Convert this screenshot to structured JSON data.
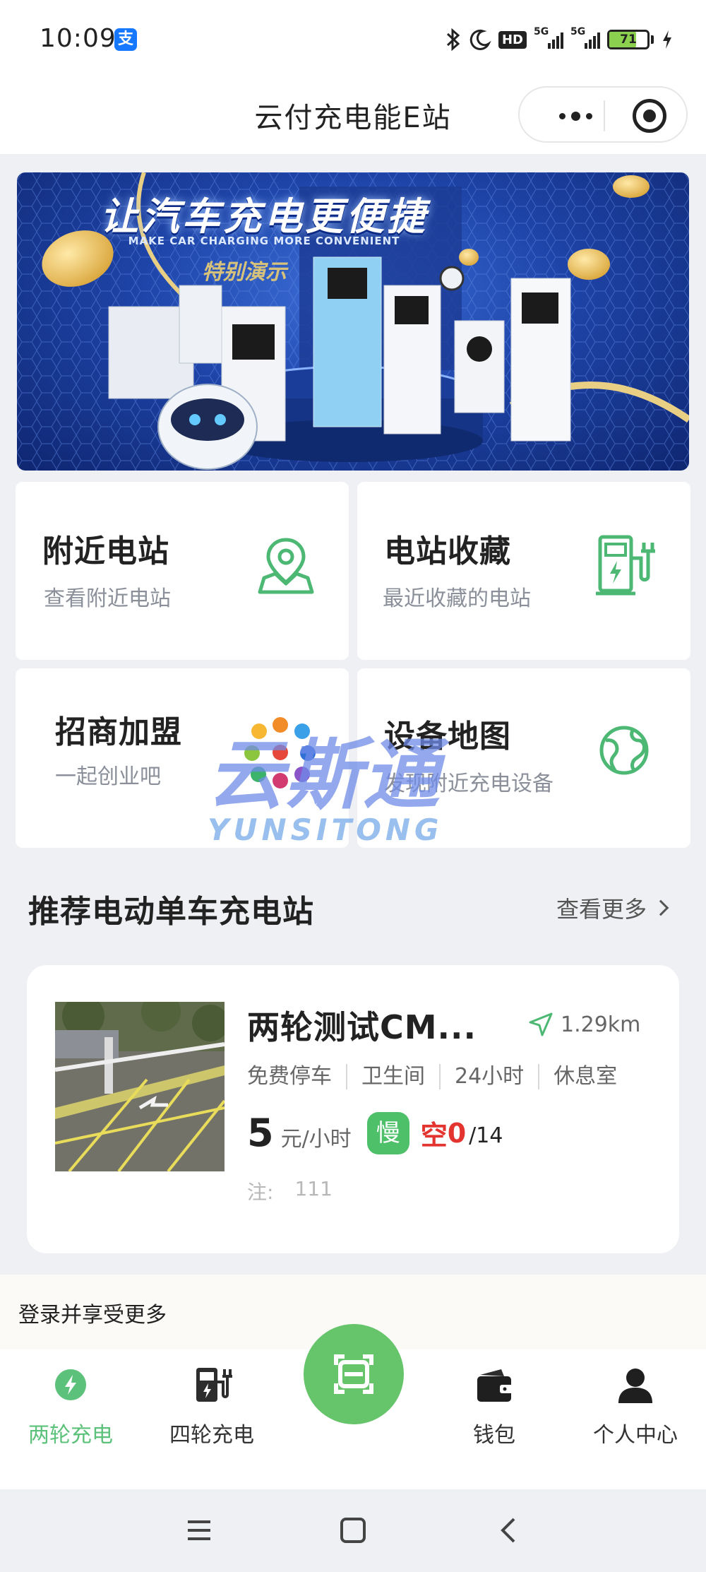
{
  "status_bar": {
    "time": "10:09",
    "alipay_icon": "支",
    "hd_label": "HD",
    "network_1": "5G",
    "network_2": "5G",
    "battery_level": "71",
    "battery_fraction": 0.71
  },
  "header": {
    "title": "云付充电能E站",
    "more_icon": "more-dots-icon",
    "close_icon": "target-circle-icon"
  },
  "banner": {
    "title": "让汽车充电更便捷",
    "subtitle": "MAKE CAR CHARGING MORE CONVENIENT",
    "tag": "特别演示"
  },
  "tiles": [
    {
      "title": "附近电站",
      "subtitle": "查看附近电站",
      "icon": "map-pin-icon"
    },
    {
      "title": "电站收藏",
      "subtitle": "最近收藏的电站",
      "icon": "charging-pile-icon"
    },
    {
      "title": "招商加盟",
      "subtitle": "一起创业吧",
      "icon": "colorful-dots-logo-icon"
    },
    {
      "title": "设备地图",
      "subtitle": "发现附近充电设备",
      "icon": "globe-map-icon"
    }
  ],
  "watermark": {
    "cn": "云斯通",
    "en": "YUNSITONG"
  },
  "section": {
    "title": "推荐电动单车充电站",
    "more": "查看更多"
  },
  "station": {
    "name": "两轮测试CM...",
    "distance": "1.29km",
    "amenities": [
      "免费停车",
      "卫生间",
      "24小时",
      "休息室"
    ],
    "price": "5",
    "price_unit": "元/小时",
    "speed_badge": "慢",
    "free_label": "空",
    "free_count": "0",
    "total_count": "/14",
    "note_label": "注:",
    "note_value": "111"
  },
  "login_prompt": "登录并享受更多",
  "tabbar": {
    "items": [
      {
        "label": "两轮充电",
        "icon": "lightning-icon",
        "active": true
      },
      {
        "label": "四轮充电",
        "icon": "fuel-pump-icon",
        "active": false
      },
      {
        "label": "钱包",
        "icon": "wallet-icon",
        "active": false
      },
      {
        "label": "个人中心",
        "icon": "user-icon",
        "active": false
      }
    ],
    "scan_icon": "scan-icon"
  },
  "colors": {
    "accent_green": "#5cc17a",
    "scan_green": "#66c46b",
    "alert_red": "#e3342f",
    "icon_green": "#4cb873"
  }
}
